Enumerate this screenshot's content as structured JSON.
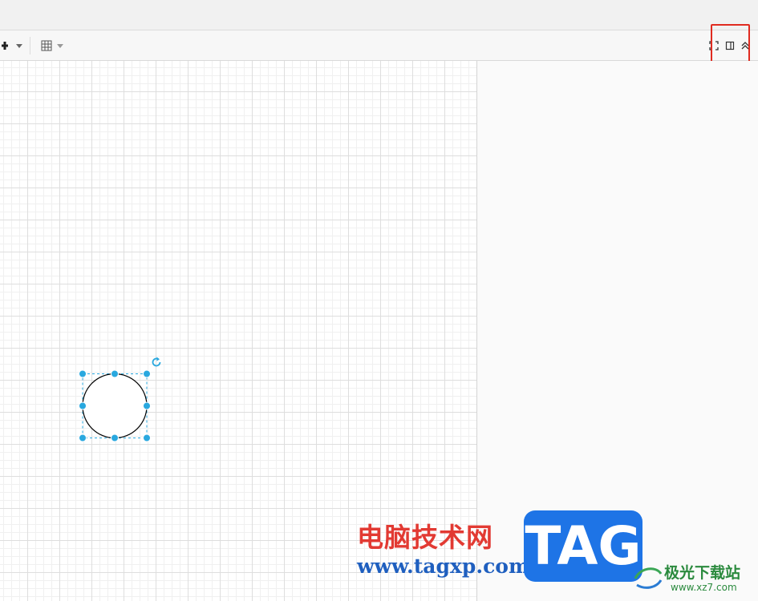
{
  "toolbar": {
    "add_icon": "plus-icon",
    "table_icon": "table-grid-icon",
    "fullscreen_icon": "fullscreen-icon",
    "format_panel_icon": "toggle-format-panel-icon",
    "collapse_icon": "collapse-double-chevron-icon"
  },
  "canvas": {
    "shape": "circle",
    "selected": true,
    "handle_color": "#29a8df",
    "outline_color": "#000000"
  },
  "highlight": {
    "color": "#e02b20"
  },
  "watermark": {
    "text": "电脑技术网",
    "url": "www.tagxp.com",
    "tag": "TAG",
    "site_name": "极光下载站",
    "site_url": "www.xz7.com"
  }
}
